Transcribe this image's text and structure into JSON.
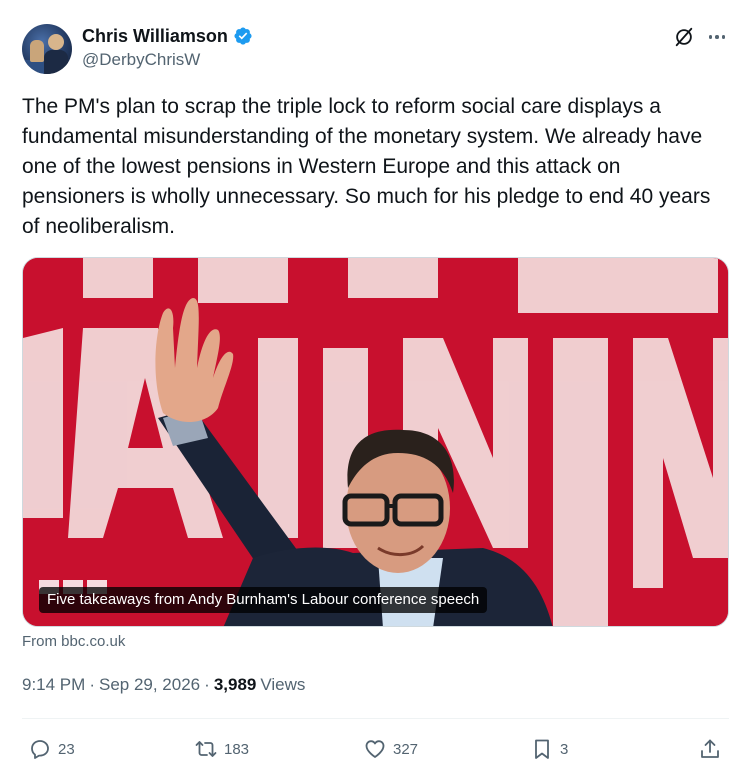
{
  "author": {
    "display_name": "Chris Williamson",
    "handle": "@DerbyChrisW",
    "verified": true,
    "verified_color": "#1d9bf0"
  },
  "tweet": {
    "text": "The PM's plan to scrap the triple lock to reform social care displays a fundamental misunderstanding of the monetary system. We already have one of the lowest pensions in Western Europe and this attack on pensioners is wholly unnecessary. So much for his pledge to end 40 years of neoliberalism."
  },
  "card": {
    "caption": "Five takeaways from Andy Burnham's Labour conference speech",
    "source": "From bbc.co.uk",
    "background_color": "#c8102e",
    "image_description_icon": "photo-man-waving"
  },
  "meta": {
    "time": "9:14 PM",
    "separator": "·",
    "date": "Sep 29, 2026",
    "views_count": "3,989",
    "views_label": "Views"
  },
  "actions": {
    "replies": "23",
    "reposts": "183",
    "likes": "327",
    "bookmarks": "3"
  },
  "colors": {
    "text_primary": "#0f1419",
    "text_secondary": "#536471",
    "border": "#cfd9de"
  }
}
